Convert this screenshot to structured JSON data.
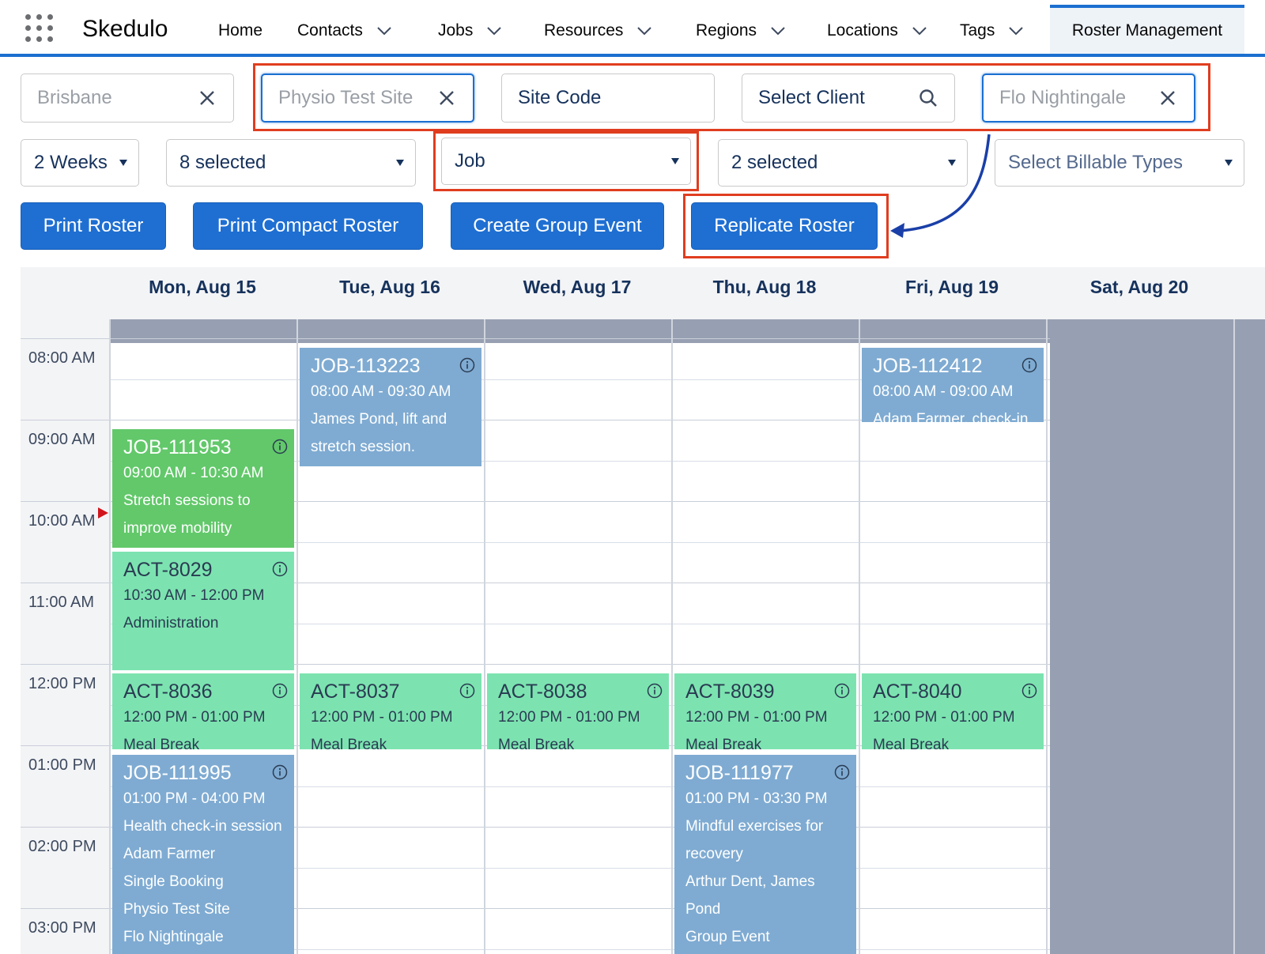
{
  "nav": {
    "app_name": "Skedulo",
    "items": [
      {
        "label": "Home",
        "has_dropdown": false
      },
      {
        "label": "Contacts",
        "has_dropdown": true
      },
      {
        "label": "Jobs",
        "has_dropdown": true
      },
      {
        "label": "Resources",
        "has_dropdown": true
      },
      {
        "label": "Regions",
        "has_dropdown": true
      },
      {
        "label": "Locations",
        "has_dropdown": true
      },
      {
        "label": "Tags",
        "has_dropdown": true
      }
    ],
    "active_tab": "Roster Management"
  },
  "filters": {
    "region": {
      "value": "Brisbane"
    },
    "site": {
      "value": "Physio Test Site"
    },
    "site_code": {
      "placeholder": "Site Code"
    },
    "client": {
      "placeholder": "Select Client"
    },
    "resource": {
      "value": "Flo Nightingale"
    }
  },
  "selects": {
    "period": "2 Weeks",
    "statuses": "8 selected",
    "type": "Job",
    "categories": "2 selected",
    "billable": "Select Billable Types"
  },
  "buttons": {
    "print": "Print Roster",
    "print_compact": "Print Compact Roster",
    "group_event": "Create Group Event",
    "replicate": "Replicate Roster"
  },
  "calendar": {
    "days": [
      "Mon, Aug 15",
      "Tue, Aug 16",
      "Wed, Aug 17",
      "Thu, Aug 18",
      "Fri, Aug 19",
      "Sat, Aug 20"
    ],
    "times": [
      "08:00 AM",
      "09:00 AM",
      "10:00 AM",
      "11:00 AM",
      "12:00 PM",
      "01:00 PM",
      "02:00 PM",
      "03:00 PM"
    ],
    "events": [
      {
        "code": "JOB-113223",
        "time": "08:00 AM - 09:30 AM",
        "details": [
          "James Pond, lift and",
          "stretch session."
        ]
      },
      {
        "code": "JOB-112412",
        "time": "08:00 AM - 09:00 AM",
        "details": [
          "Adam Farmer, check-in"
        ]
      },
      {
        "code": "JOB-111953",
        "time": "09:00 AM - 10:30 AM",
        "details": [
          "Stretch sessions to",
          "improve mobility"
        ]
      },
      {
        "code": "ACT-8029",
        "time": "10:30 AM - 12:00 PM",
        "details": [
          "Administration"
        ]
      },
      {
        "code": "ACT-8036",
        "time": "12:00 PM - 01:00 PM",
        "details": [
          "Meal Break"
        ]
      },
      {
        "code": "ACT-8037",
        "time": "12:00 PM - 01:00 PM",
        "details": [
          "Meal Break"
        ]
      },
      {
        "code": "ACT-8038",
        "time": "12:00 PM - 01:00 PM",
        "details": [
          "Meal Break"
        ]
      },
      {
        "code": "ACT-8039",
        "time": "12:00 PM - 01:00 PM",
        "details": [
          "Meal Break"
        ]
      },
      {
        "code": "ACT-8040",
        "time": "12:00 PM - 01:00 PM",
        "details": [
          "Meal Break"
        ]
      },
      {
        "code": "JOB-111995",
        "time": "01:00 PM - 04:00 PM",
        "details": [
          "Health check-in session",
          "Adam Farmer",
          "Single Booking",
          "Physio Test Site",
          "Flo Nightingale"
        ]
      },
      {
        "code": "JOB-111977",
        "time": "01:00 PM - 03:30 PM",
        "details": [
          "Mindful exercises for",
          "recovery",
          "Arthur Dent, James",
          "Pond",
          "Group Event"
        ]
      }
    ]
  },
  "colors": {
    "accent": "#1f6fd2",
    "job_event": "#7fabd2",
    "activity_event": "#7ce3b0",
    "highlight": "#e03d1f",
    "arrow": "#1a3fa8"
  }
}
